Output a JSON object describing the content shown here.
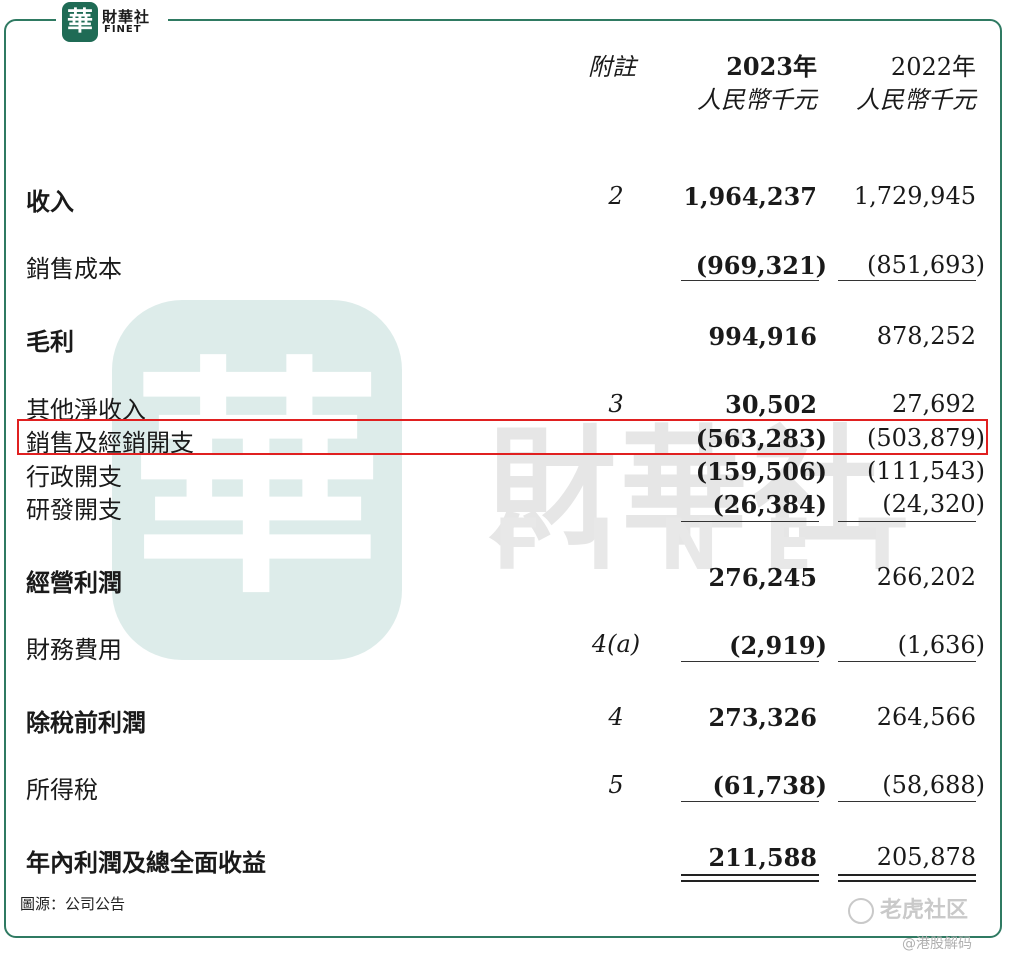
{
  "brand": {
    "logo_char": "華",
    "name_cn": "財華社",
    "name_en": "FINET"
  },
  "watermark": {
    "char": "華",
    "cn": "財華社",
    "en": "FINET"
  },
  "header": {
    "note": "附註",
    "col_2023_year": "2023年",
    "col_2023_unit": "人民幣千元",
    "col_2022_year": "2022年",
    "col_2022_unit": "人民幣千元"
  },
  "rows": [
    {
      "label": "收入",
      "note": "2",
      "v2023": "1,964,237",
      "v2022": "1,729,945"
    },
    {
      "label": "銷售成本",
      "note": "",
      "v2023": "(969,321)",
      "v2022": "(851,693)"
    },
    {
      "label": "毛利",
      "note": "",
      "v2023": "994,916",
      "v2022": "878,252"
    },
    {
      "label": "其他淨收入",
      "note": "3",
      "v2023": "30,502",
      "v2022": "27,692"
    },
    {
      "label": "銷售及經銷開支",
      "note": "",
      "v2023": "(563,283)",
      "v2022": "(503,879)"
    },
    {
      "label": "行政開支",
      "note": "",
      "v2023": "(159,506)",
      "v2022": "(111,543)"
    },
    {
      "label": "研發開支",
      "note": "",
      "v2023": "(26,384)",
      "v2022": "(24,320)"
    },
    {
      "label": "經營利潤",
      "note": "",
      "v2023": "276,245",
      "v2022": "266,202"
    },
    {
      "label": "財務費用",
      "note": "4(a)",
      "v2023": "(2,919)",
      "v2022": "(1,636)"
    },
    {
      "label": "除稅前利潤",
      "note": "4",
      "v2023": "273,326",
      "v2022": "264,566"
    },
    {
      "label": "所得稅",
      "note": "5",
      "v2023": "(61,738)",
      "v2022": "(58,688)"
    },
    {
      "label": "年內利潤及總全面收益",
      "note": "",
      "v2023": "211,588",
      "v2022": "205,878"
    }
  ],
  "footer": {
    "source": "圖源：公司公告",
    "tiger": "老虎社区",
    "handle": "@港股解码"
  },
  "colors": {
    "brand_green": "#1f6b55",
    "highlight": "#e02020"
  }
}
